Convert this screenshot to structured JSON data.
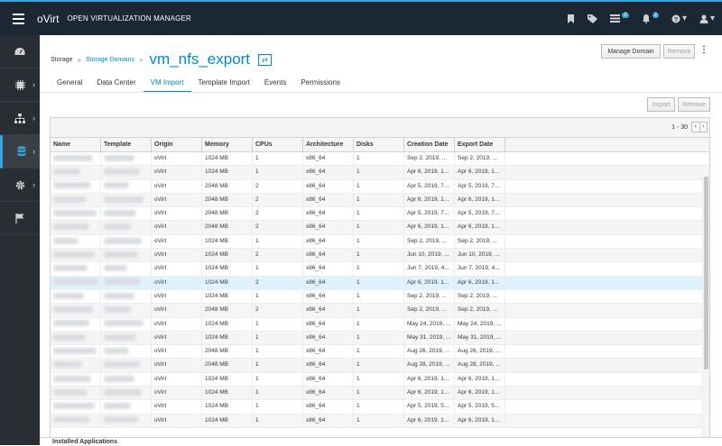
{
  "header": {
    "logo": "oVirt",
    "title": "OPEN VIRTUALIZATION MANAGER",
    "badges": {
      "tasks": "0",
      "events": "2"
    }
  },
  "sidebar": {
    "items": [
      {
        "name": "dashboard",
        "icon": "dashboard-icon"
      },
      {
        "name": "compute",
        "icon": "chip-icon"
      },
      {
        "name": "network",
        "icon": "network-icon"
      },
      {
        "name": "storage",
        "icon": "database-icon",
        "active": true
      },
      {
        "name": "administration",
        "icon": "gear-icon"
      },
      {
        "name": "events",
        "icon": "flag-icon"
      }
    ]
  },
  "breadcrumb": {
    "root": "Storage",
    "section": "Storage Domains",
    "title": "vm_nfs_export"
  },
  "actions": {
    "manage": "Manage Domain",
    "remove": "Remove"
  },
  "tabs": [
    "General",
    "Data Center",
    "VM Import",
    "Template Import",
    "Events",
    "Permissions"
  ],
  "active_tab": "VM Import",
  "panel_actions": {
    "import": "Import",
    "remove": "Remove"
  },
  "pager": {
    "range": "1 - 30"
  },
  "table": {
    "columns": [
      "Name",
      "Template",
      "Origin",
      "Memory",
      "CPUs",
      "Architecture",
      "Disks",
      "Creation Date",
      "Export Date"
    ],
    "rows": [
      [
        "oVirt",
        "1024 MB",
        "1",
        "x86_64",
        "1",
        "Sep 2, 2019, ...",
        "Sep 2, 2019, ..."
      ],
      [
        "oVirt",
        "1024 MB",
        "1",
        "x86_64",
        "1",
        "Apr 6, 2019, 1...",
        "Apr 6, 2019, 1..."
      ],
      [
        "oVirt",
        "2048 MB",
        "2",
        "x86_64",
        "1",
        "Apr 5, 2019, 7...",
        "Apr 5, 2019, 7..."
      ],
      [
        "oVirt",
        "2048 MB",
        "2",
        "x86_64",
        "1",
        "Apr 6, 2019, 1...",
        "Apr 6, 2019, 1..."
      ],
      [
        "oVirt",
        "2048 MB",
        "2",
        "x86_64",
        "1",
        "Apr 5, 2019, 7...",
        "Apr 5, 2019, 7..."
      ],
      [
        "oVirt",
        "2048 MB",
        "2",
        "x86_64",
        "1",
        "Apr 6, 2019, 1...",
        "Apr 6, 2019, 1..."
      ],
      [
        "oVirt",
        "1024 MB",
        "1",
        "x86_64",
        "1",
        "Sep 2, 2019, ...",
        "Sep 2, 2019, ..."
      ],
      [
        "oVirt",
        "1024 MB",
        "2",
        "x86_64",
        "1",
        "Jun 10, 2019, ...",
        "Jun 10, 2019, ..."
      ],
      [
        "oVirt",
        "1024 MB",
        "1",
        "x86_64",
        "1",
        "Jun 7, 2019, 4...",
        "Jun 7, 2019, 4..."
      ],
      [
        "oVirt",
        "1024 MB",
        "2",
        "x86_64",
        "1",
        "Apr 6, 2019, 1...",
        "Apr 6, 2019, 1..."
      ],
      [
        "oVirt",
        "1024 MB",
        "1",
        "x86_64",
        "1",
        "Sep 2, 2019, ...",
        "Sep 2, 2019, ..."
      ],
      [
        "oVirt",
        "2048 MB",
        "2",
        "x86_64",
        "1",
        "Sep 2, 2019, ...",
        "Sep 2, 2019, ..."
      ],
      [
        "oVirt",
        "1024 MB",
        "1",
        "x86_64",
        "1",
        "May 24, 2019, ...",
        "May 24, 2019, ..."
      ],
      [
        "oVirt",
        "1024 MB",
        "1",
        "x86_64",
        "1",
        "May 31, 2019, ...",
        "May 31, 2019, ..."
      ],
      [
        "oVirt",
        "2048 MB",
        "1",
        "x86_64",
        "1",
        "Aug 26, 2019, ...",
        "Aug 26, 2019, ..."
      ],
      [
        "oVirt",
        "2048 MB",
        "1",
        "x86_64",
        "1",
        "Aug 28, 2019, ...",
        "Aug 28, 2019, ..."
      ],
      [
        "oVirt",
        "1024 MB",
        "1",
        "x86_64",
        "1",
        "Apr 6, 2019, 1...",
        "Apr 6, 2019, 1..."
      ],
      [
        "oVirt",
        "1024 MB",
        "1",
        "x86_64",
        "1",
        "Apr 6, 2019, 1...",
        "Apr 6, 2019, 1..."
      ],
      [
        "oVirt",
        "1024 MB",
        "1",
        "x86_64",
        "1",
        "Apr 5, 2019, 5...",
        "Apr 5, 2019, 5..."
      ],
      [
        "oVirt",
        "1024 MB",
        "1",
        "x86_64",
        "1",
        "Apr 6, 2019, 1...",
        "Apr 6, 2019, 1..."
      ]
    ],
    "selected_row": 9
  },
  "footer": {
    "label": "Installed Applications"
  },
  "colors": {
    "accent": "#0088ce",
    "topbar": "#1b2833",
    "sidebar": "#292e34",
    "selected_row": "#def3ff"
  }
}
